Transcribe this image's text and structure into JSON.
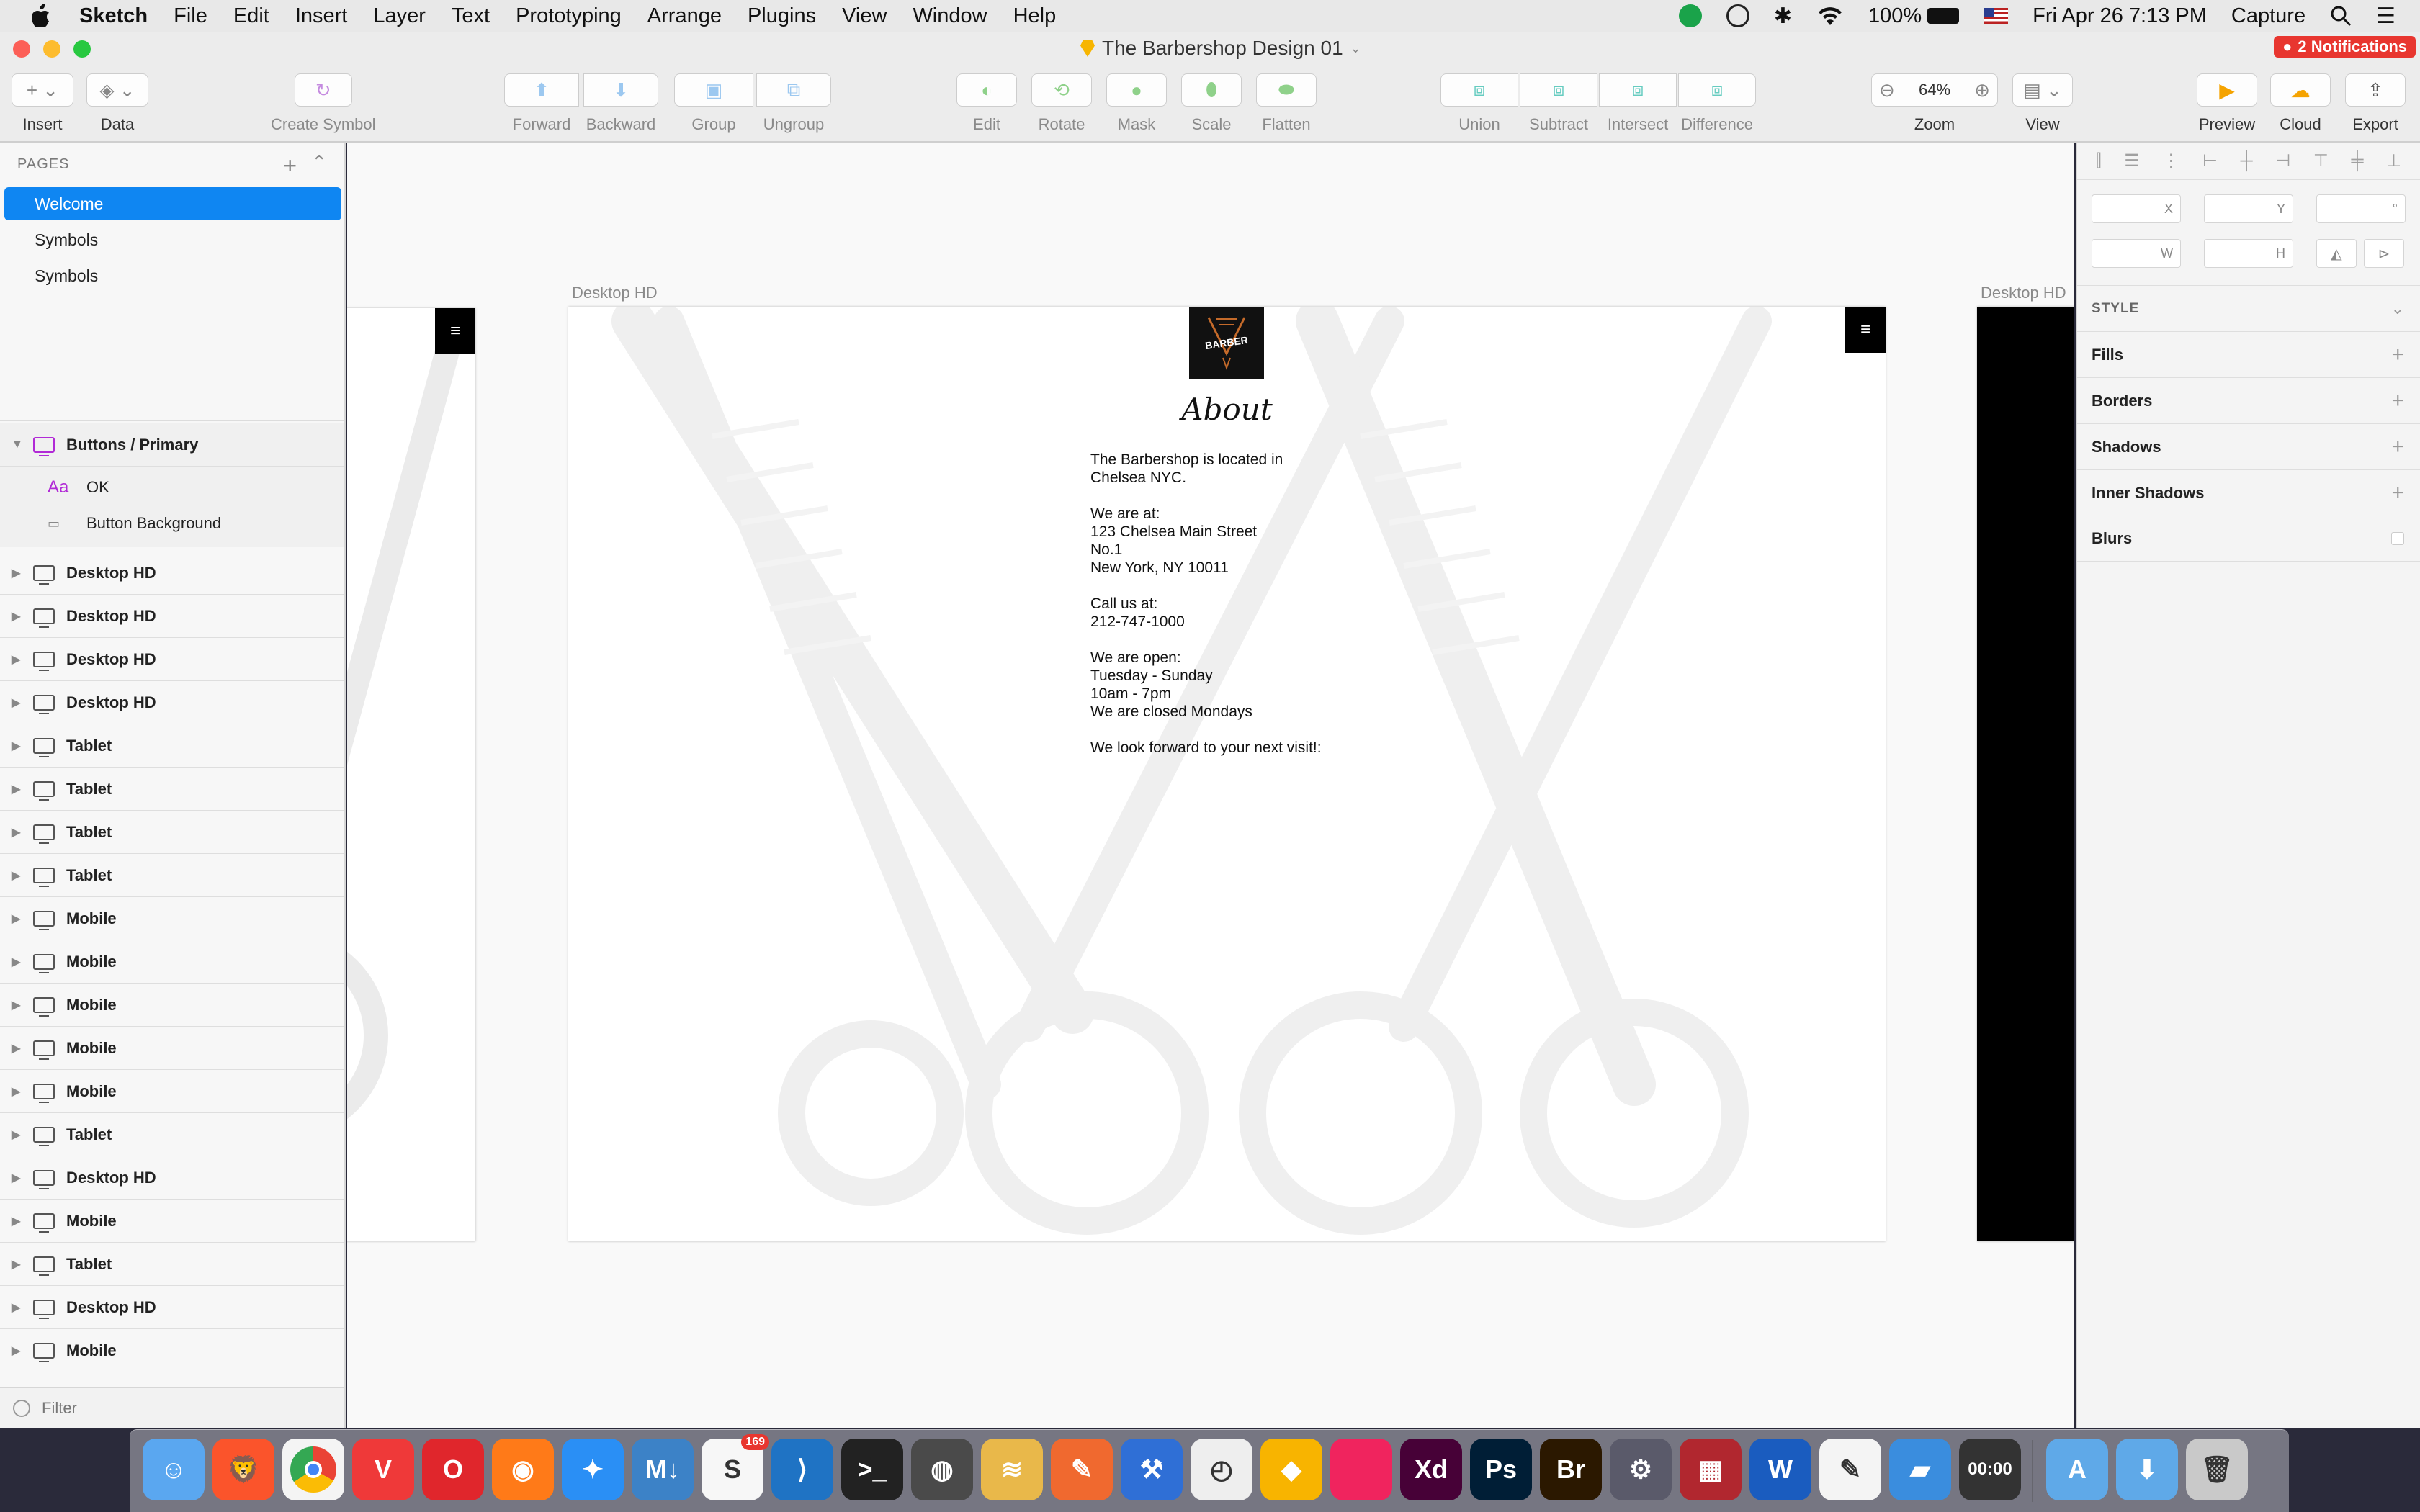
{
  "menubar": {
    "app": "Sketch",
    "items": [
      "File",
      "Edit",
      "Insert",
      "Layer",
      "Text",
      "Prototyping",
      "Arrange",
      "Plugins",
      "View",
      "Window",
      "Help"
    ],
    "battery": "100%",
    "datetime": "Fri Apr 26  7:13 PM",
    "capture": "Capture"
  },
  "window": {
    "title": "The Barbershop Design 01",
    "notifications": "2 Notifications"
  },
  "toolbar": {
    "insert": "Insert",
    "data": "Data",
    "create_symbol": "Create Symbol",
    "forward": "Forward",
    "backward": "Backward",
    "group": "Group",
    "ungroup": "Ungroup",
    "edit": "Edit",
    "rotate": "Rotate",
    "mask": "Mask",
    "scale": "Scale",
    "flatten": "Flatten",
    "union": "Union",
    "subtract": "Subtract",
    "intersect": "Intersect",
    "difference": "Difference",
    "zoom_value": "64%",
    "zoom": "Zoom",
    "view": "View",
    "preview": "Preview",
    "cloud": "Cloud",
    "export": "Export"
  },
  "sidebar": {
    "pages_header": "PAGES",
    "pages": [
      "Welcome",
      "Symbols",
      "Symbols"
    ],
    "symbol_group": "Buttons / Primary",
    "symbol_children": [
      "OK",
      "Button Background"
    ],
    "layers": [
      "Desktop HD",
      "Desktop HD",
      "Desktop HD",
      "Desktop HD",
      "Tablet",
      "Tablet",
      "Tablet",
      "Tablet",
      "Mobile",
      "Mobile",
      "Mobile",
      "Mobile",
      "Mobile",
      "Tablet",
      "Desktop HD",
      "Mobile",
      "Tablet",
      "Desktop HD",
      "Mobile"
    ],
    "filter": "Filter"
  },
  "canvas": {
    "artboard_label_main": "Desktop HD",
    "artboard_label_right": "Desktop HD",
    "logo_text": "BARBER",
    "hamburger": "≡",
    "about_title": "About",
    "about_lines": [
      "The Barbershop is located in",
      "Chelsea NYC.",
      "",
      "We are at:",
      "123 Chelsea Main Street",
      "No.1",
      "New York, NY 10011",
      "",
      "Call us at:",
      "212-747-1000",
      "",
      "We are open:",
      "Tuesday - Sunday",
      "10am - 7pm",
      "We are closed Mondays",
      "",
      "We look forward to your next visit!:"
    ]
  },
  "inspector": {
    "x_label": "X",
    "y_label": "Y",
    "deg_label": "°",
    "w_label": "W",
    "h_label": "H",
    "style": "STYLE",
    "sections": [
      "Fills",
      "Borders",
      "Shadows",
      "Inner Shadows",
      "Blurs"
    ]
  },
  "dock": {
    "apps": [
      "Finder",
      "Brave",
      "Chrome",
      "Vivaldi",
      "Opera",
      "Firefox",
      "Safari",
      "MacDown",
      "Slack",
      "VS Code",
      "Terminal",
      "TablePlus",
      "Sequel Pro",
      "Postman",
      "Xcode",
      "Clock",
      "Sketch",
      "Framer",
      "Adobe XD",
      "Photoshop",
      "Bridge",
      "System Preferences",
      "Photo Booth",
      "Word",
      "TextEdit",
      "Keynote",
      "Capture",
      "Applications",
      "Downloads",
      "Trash"
    ],
    "slack_badge": "169",
    "capture_time": "00:00",
    "xd": "Xd",
    "ps": "Ps",
    "br": "Br",
    "word": "W"
  },
  "colors": {
    "selection": "#0f86f2",
    "symbol_purple": "#b12ad6",
    "notification_red": "#e8362f"
  }
}
